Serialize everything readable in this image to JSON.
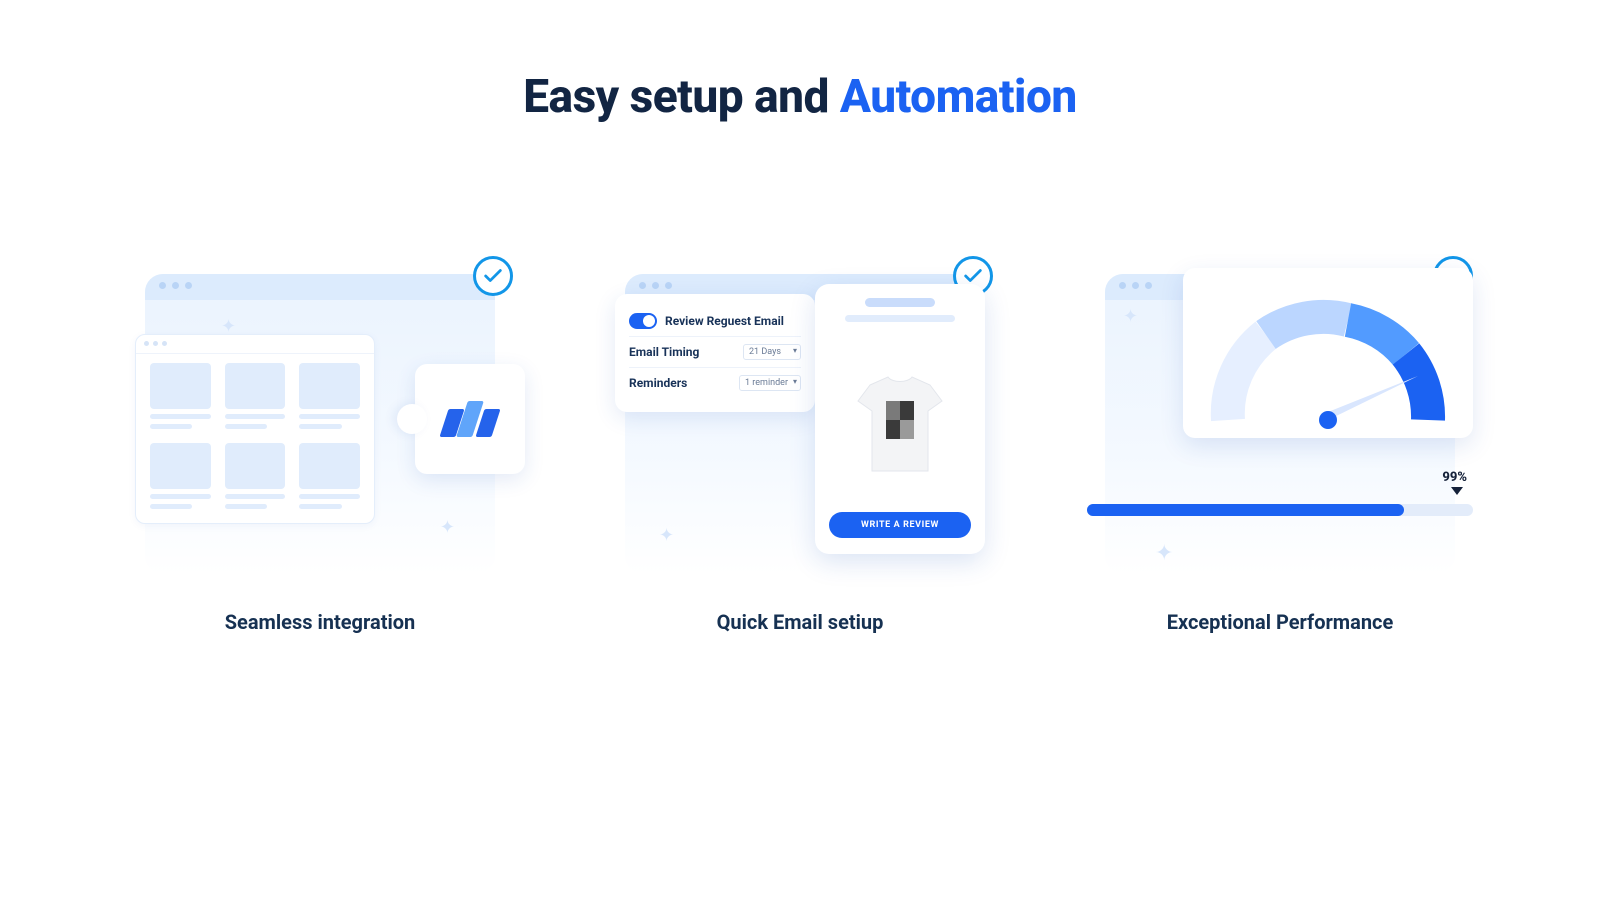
{
  "headline": {
    "prefix": "Easy setup and ",
    "accent": "Automation"
  },
  "cards": {
    "integration": {
      "title": "Seamless integration"
    },
    "email": {
      "title": "Quick Email setiup",
      "toggle_label": "Review Reguest Email",
      "timing_label": "Email Timing",
      "timing_value": "21 Days",
      "reminders_label": "Reminders",
      "reminders_value": "1 reminder",
      "cta": "WRITE A REVIEW"
    },
    "performance": {
      "title": "Exceptional Performance",
      "percent_label": "99%"
    }
  }
}
